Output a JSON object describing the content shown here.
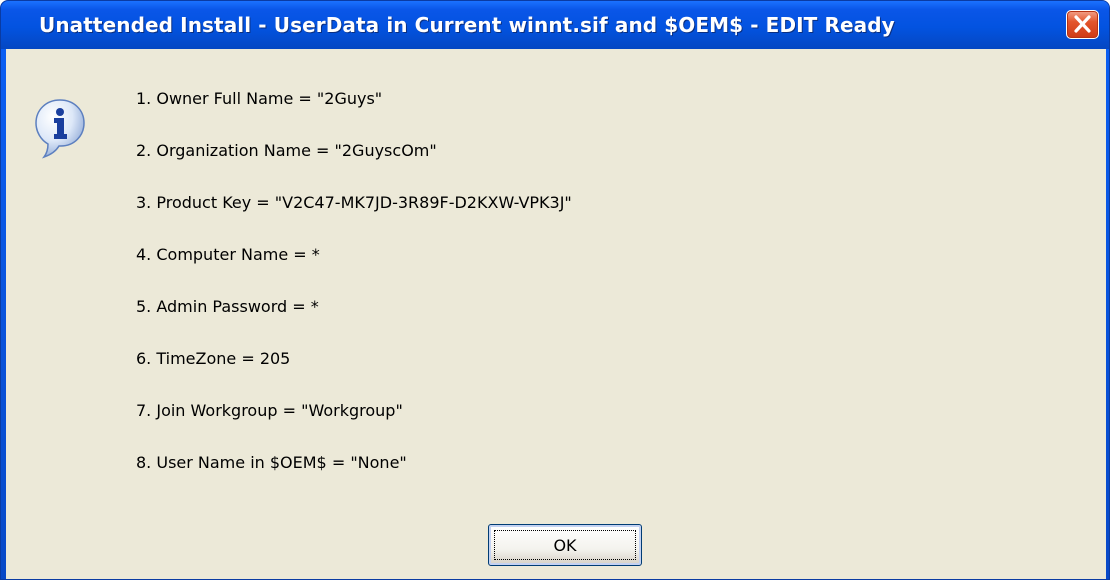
{
  "dialog": {
    "title": "Unattended Install - UserData in Current winnt.sif and $OEM$ - EDIT Ready",
    "icon": "information-icon",
    "close_icon": "close-icon",
    "colors": {
      "titlebar": "#0a56e8",
      "client_background": "#ece9d8",
      "close_button": "#e3552c"
    },
    "lines": [
      "1. Owner Full Name = \"2Guys\"",
      "2. Organization Name = \"2GuyscOm\"",
      "3. Product Key = \"V2C47-MK7JD-3R89F-D2KXW-VPK3J\"",
      "4. Computer Name = *",
      "5. Admin Password = *",
      "6. TimeZone = 205",
      "7. Join Workgroup = \"Workgroup\"",
      "8. User Name in $OEM$ = \"None\""
    ],
    "ok_label": "OK"
  }
}
